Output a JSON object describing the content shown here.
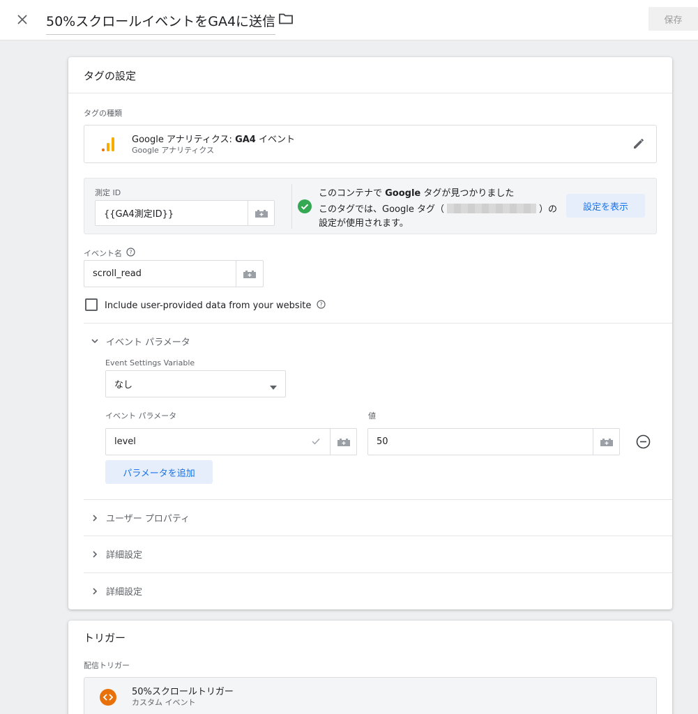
{
  "header": {
    "title": "50%スクロールイベントをGA4に送信",
    "save_label": "保存"
  },
  "tag_config": {
    "heading": "タグの設定",
    "tag_type_label": "タグの種類",
    "tag_type_name_prefix": "Google アナリティクス: ",
    "tag_type_name_bold": "GA4",
    "tag_type_name_suffix": " イベント",
    "tag_type_sub": "Google アナリティクス",
    "measurement_id_label": "測定 ID",
    "measurement_id_value": "{{GA4測定ID}}",
    "google_tag_found_prefix": "このコンテナで ",
    "google_tag_found_bold": "Google",
    "google_tag_found_suffix": " タグが見つかりました",
    "google_tag_usage_line1_prefix": "このタグでは、Google タグ（",
    "google_tag_usage_line1_suffix": "）の",
    "google_tag_usage_line2": "設定が使用されます。",
    "show_settings_label": "設定を表示",
    "event_name_label": "イベント名",
    "event_name_value": "scroll_read",
    "include_user_data_label": "Include user-provided data from your website",
    "event_params_section": "イベント パラメータ",
    "event_settings_variable_label": "Event Settings Variable",
    "event_settings_variable_value": "なし",
    "param_col_label": "イベント パラメータ",
    "value_col_label": "値",
    "param_name": "level",
    "param_value": "50",
    "add_param_label": "パラメータを追加",
    "user_properties_section": "ユーザー プロパティ",
    "advanced_settings_1": "詳細設定",
    "advanced_settings_2": "詳細設定"
  },
  "trigger": {
    "heading": "トリガー",
    "firing_label": "配信トリガー",
    "name": "50%スクロールトリガー",
    "type": "カスタム イベント"
  },
  "colors": {
    "accent_blue": "#1a73e8",
    "ga_orange": "#f9ab00",
    "success_green": "#34a853",
    "trigger_orange": "#e8710a"
  }
}
